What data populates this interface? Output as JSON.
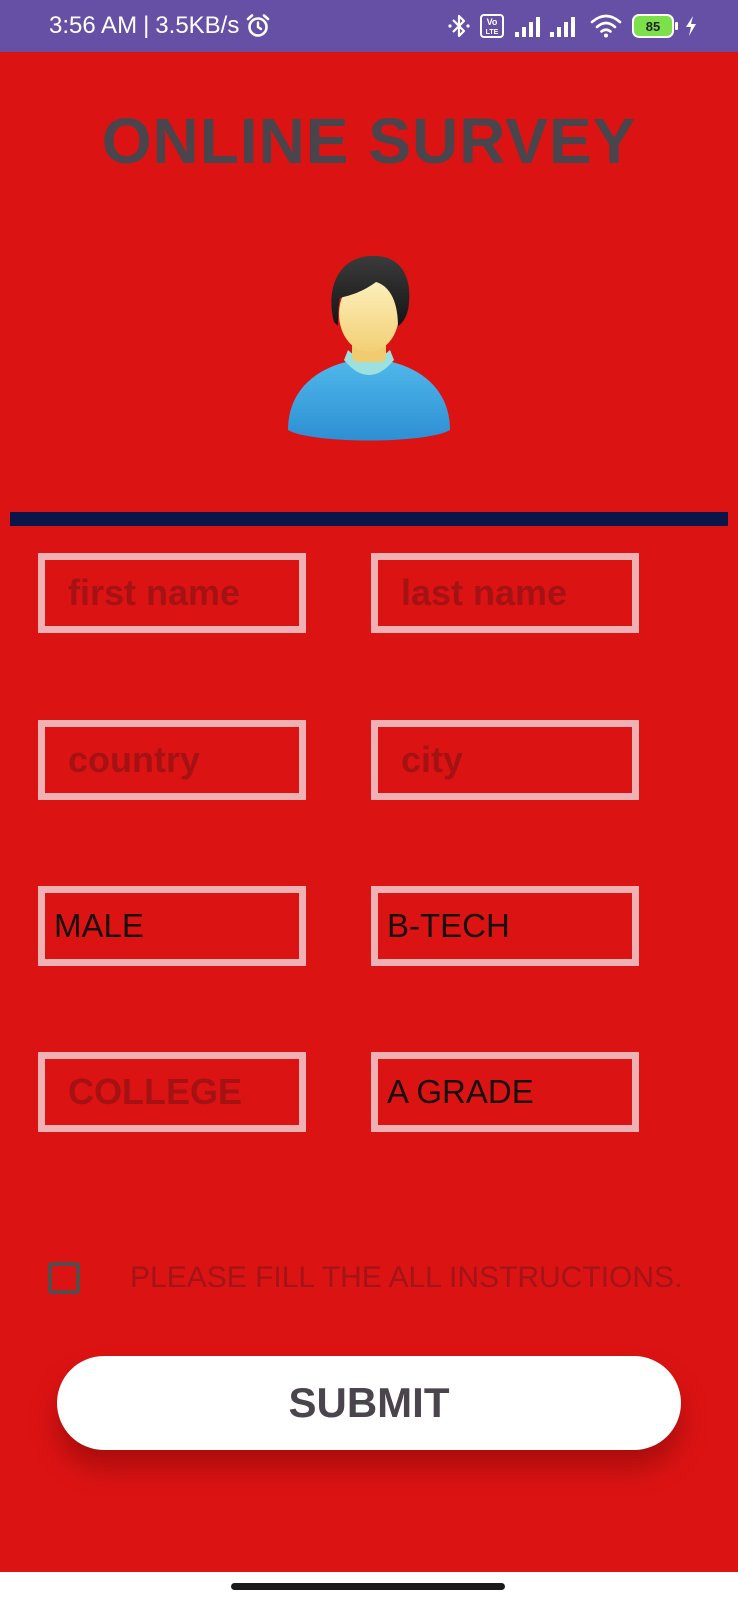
{
  "status_bar": {
    "time": "3:56 AM",
    "separator": "|",
    "speed": "3.5KB/s",
    "alarm_icon": "alarm-icon",
    "bluetooth_icon": "bluetooth-icon",
    "volte_icon": "volte-icon",
    "signal_icon": "signal-icon",
    "wifi_icon": "wifi-icon",
    "battery_level": "85",
    "charging_icon": "charging-icon"
  },
  "app": {
    "title": "ONLINE SURVEY",
    "avatar_icon": "user-avatar-icon",
    "background_color": "#dc1313",
    "divider_color": "#0c1548"
  },
  "form": {
    "first_name": {
      "placeholder": "first name",
      "value": ""
    },
    "last_name": {
      "placeholder": "last name",
      "value": ""
    },
    "country": {
      "placeholder": "country",
      "value": ""
    },
    "city": {
      "placeholder": "city",
      "value": ""
    },
    "gender": {
      "value": "MALE"
    },
    "degree": {
      "value": "B-TECH"
    },
    "college": {
      "placeholder": "COLLEGE",
      "value": ""
    },
    "grade": {
      "value": "A GRADE"
    },
    "instructions_checkbox": {
      "checked": false,
      "label": "PLEASE FILL THE ALL INSTRUCTIONS."
    },
    "submit_label": "SUBMIT"
  }
}
